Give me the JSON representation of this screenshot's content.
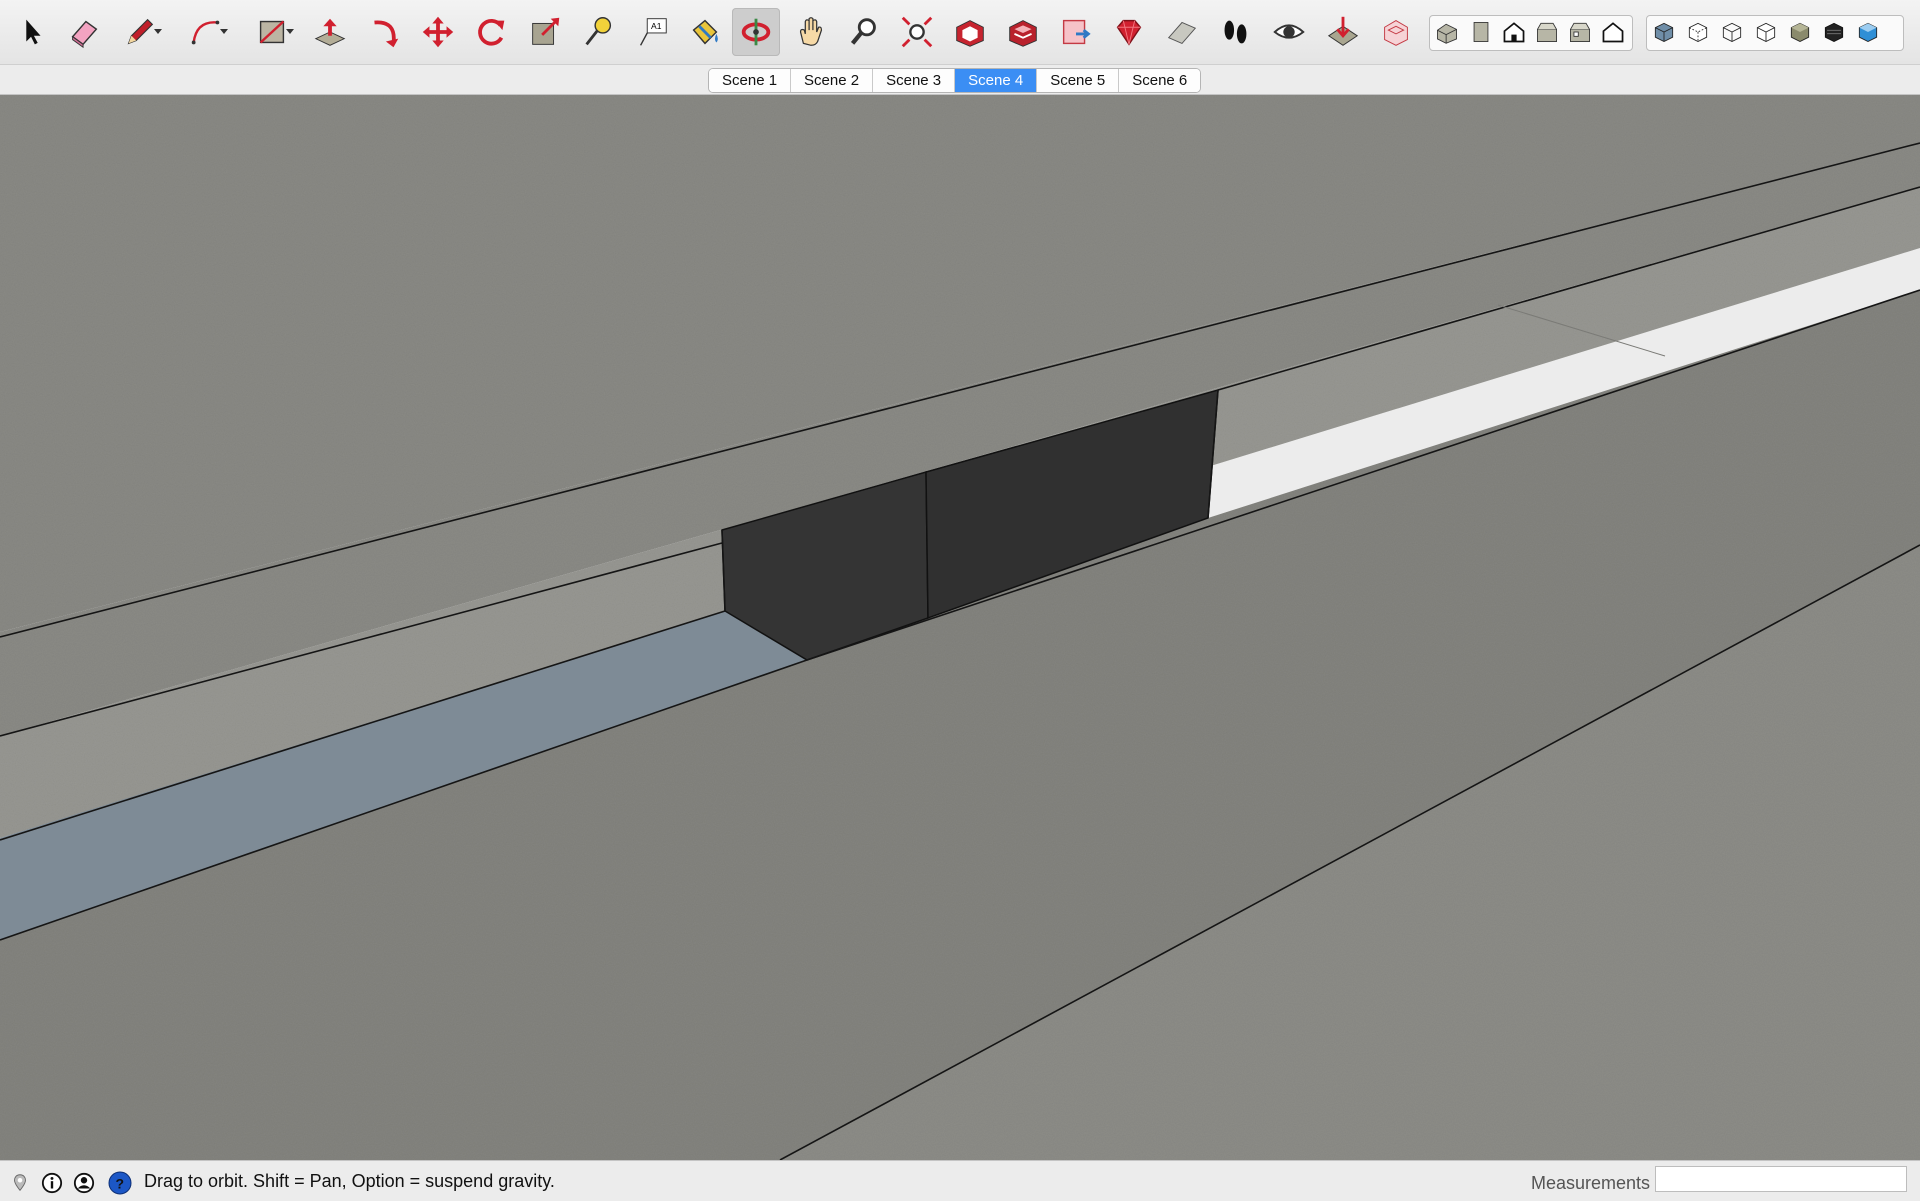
{
  "toolbar": {
    "tools": [
      {
        "name": "select-tool",
        "icon": "arrow-cursor-icon"
      },
      {
        "name": "eraser-tool",
        "icon": "eraser-icon"
      },
      {
        "name": "line-tool",
        "icon": "pencil-icon"
      },
      {
        "name": "arc-tool",
        "icon": "arc-icon"
      },
      {
        "name": "rectangle-tool",
        "icon": "rectangle-icon"
      },
      {
        "name": "push-pull-tool",
        "icon": "push-pull-icon"
      },
      {
        "name": "follow-me-tool",
        "icon": "follow-me-icon"
      },
      {
        "name": "move-tool",
        "icon": "move-arrows-icon"
      },
      {
        "name": "rotate-tool",
        "icon": "rotate-icon"
      },
      {
        "name": "scale-tool",
        "icon": "scale-icon"
      },
      {
        "name": "tape-measure-tool",
        "icon": "tape-measure-icon"
      },
      {
        "name": "text-tool",
        "icon": "text-label-icon"
      },
      {
        "name": "paint-bucket-tool",
        "icon": "paint-bucket-icon"
      },
      {
        "name": "orbit-tool",
        "icon": "orbit-icon"
      },
      {
        "name": "pan-tool",
        "icon": "hand-icon"
      },
      {
        "name": "zoom-tool",
        "icon": "magnifier-icon"
      },
      {
        "name": "zoom-extents-tool",
        "icon": "zoom-extents-icon"
      },
      {
        "name": "3d-warehouse-tool",
        "icon": "warehouse-icon"
      },
      {
        "name": "extension-warehouse-tool",
        "icon": "extension-warehouse-icon"
      },
      {
        "name": "send-to-layout-tool",
        "icon": "layout-icon"
      },
      {
        "name": "extension-manager-tool",
        "icon": "ruby-gem-icon"
      },
      {
        "name": "section-plane-tool",
        "icon": "section-plane-icon"
      },
      {
        "name": "walk-tool",
        "icon": "footprints-icon"
      },
      {
        "name": "look-around-tool",
        "icon": "eye-icon"
      },
      {
        "name": "position-camera-tool",
        "icon": "position-camera-icon"
      },
      {
        "name": "styles-tool",
        "icon": "styles-icon"
      }
    ],
    "views": [
      {
        "name": "view-iso",
        "icon": "iso-house-icon"
      },
      {
        "name": "view-top",
        "icon": "top-view-icon"
      },
      {
        "name": "view-front",
        "icon": "front-house-icon"
      },
      {
        "name": "view-right",
        "icon": "right-view-icon"
      },
      {
        "name": "view-back",
        "icon": "back-view-icon"
      },
      {
        "name": "view-left",
        "icon": "left-house-icon"
      }
    ],
    "styles": [
      {
        "name": "style-xray",
        "icon": "xray-cube-icon"
      },
      {
        "name": "style-back-edges",
        "icon": "back-edges-cube-icon"
      },
      {
        "name": "style-wireframe",
        "icon": "wireframe-cube-icon"
      },
      {
        "name": "style-hidden-line",
        "icon": "hidden-line-cube-icon"
      },
      {
        "name": "style-shaded",
        "icon": "shaded-cube-icon"
      },
      {
        "name": "style-shaded-textures",
        "icon": "textured-cube-icon"
      },
      {
        "name": "style-monochrome",
        "icon": "monochrome-cube-icon"
      }
    ]
  },
  "scenes": {
    "tabs": [
      "Scene 1",
      "Scene 2",
      "Scene 3",
      "Scene 4",
      "Scene 5",
      "Scene 6"
    ],
    "active_index": 3
  },
  "status": {
    "message": "Drag to orbit. Shift = Pan, Option = suspend gravity.",
    "measurements_label": "Measurements",
    "measurements_value": ""
  },
  "colors": {
    "accent": "#3b8ef4",
    "concrete": "#878782",
    "dark_face": "#333333",
    "water": "#7e8b96"
  }
}
